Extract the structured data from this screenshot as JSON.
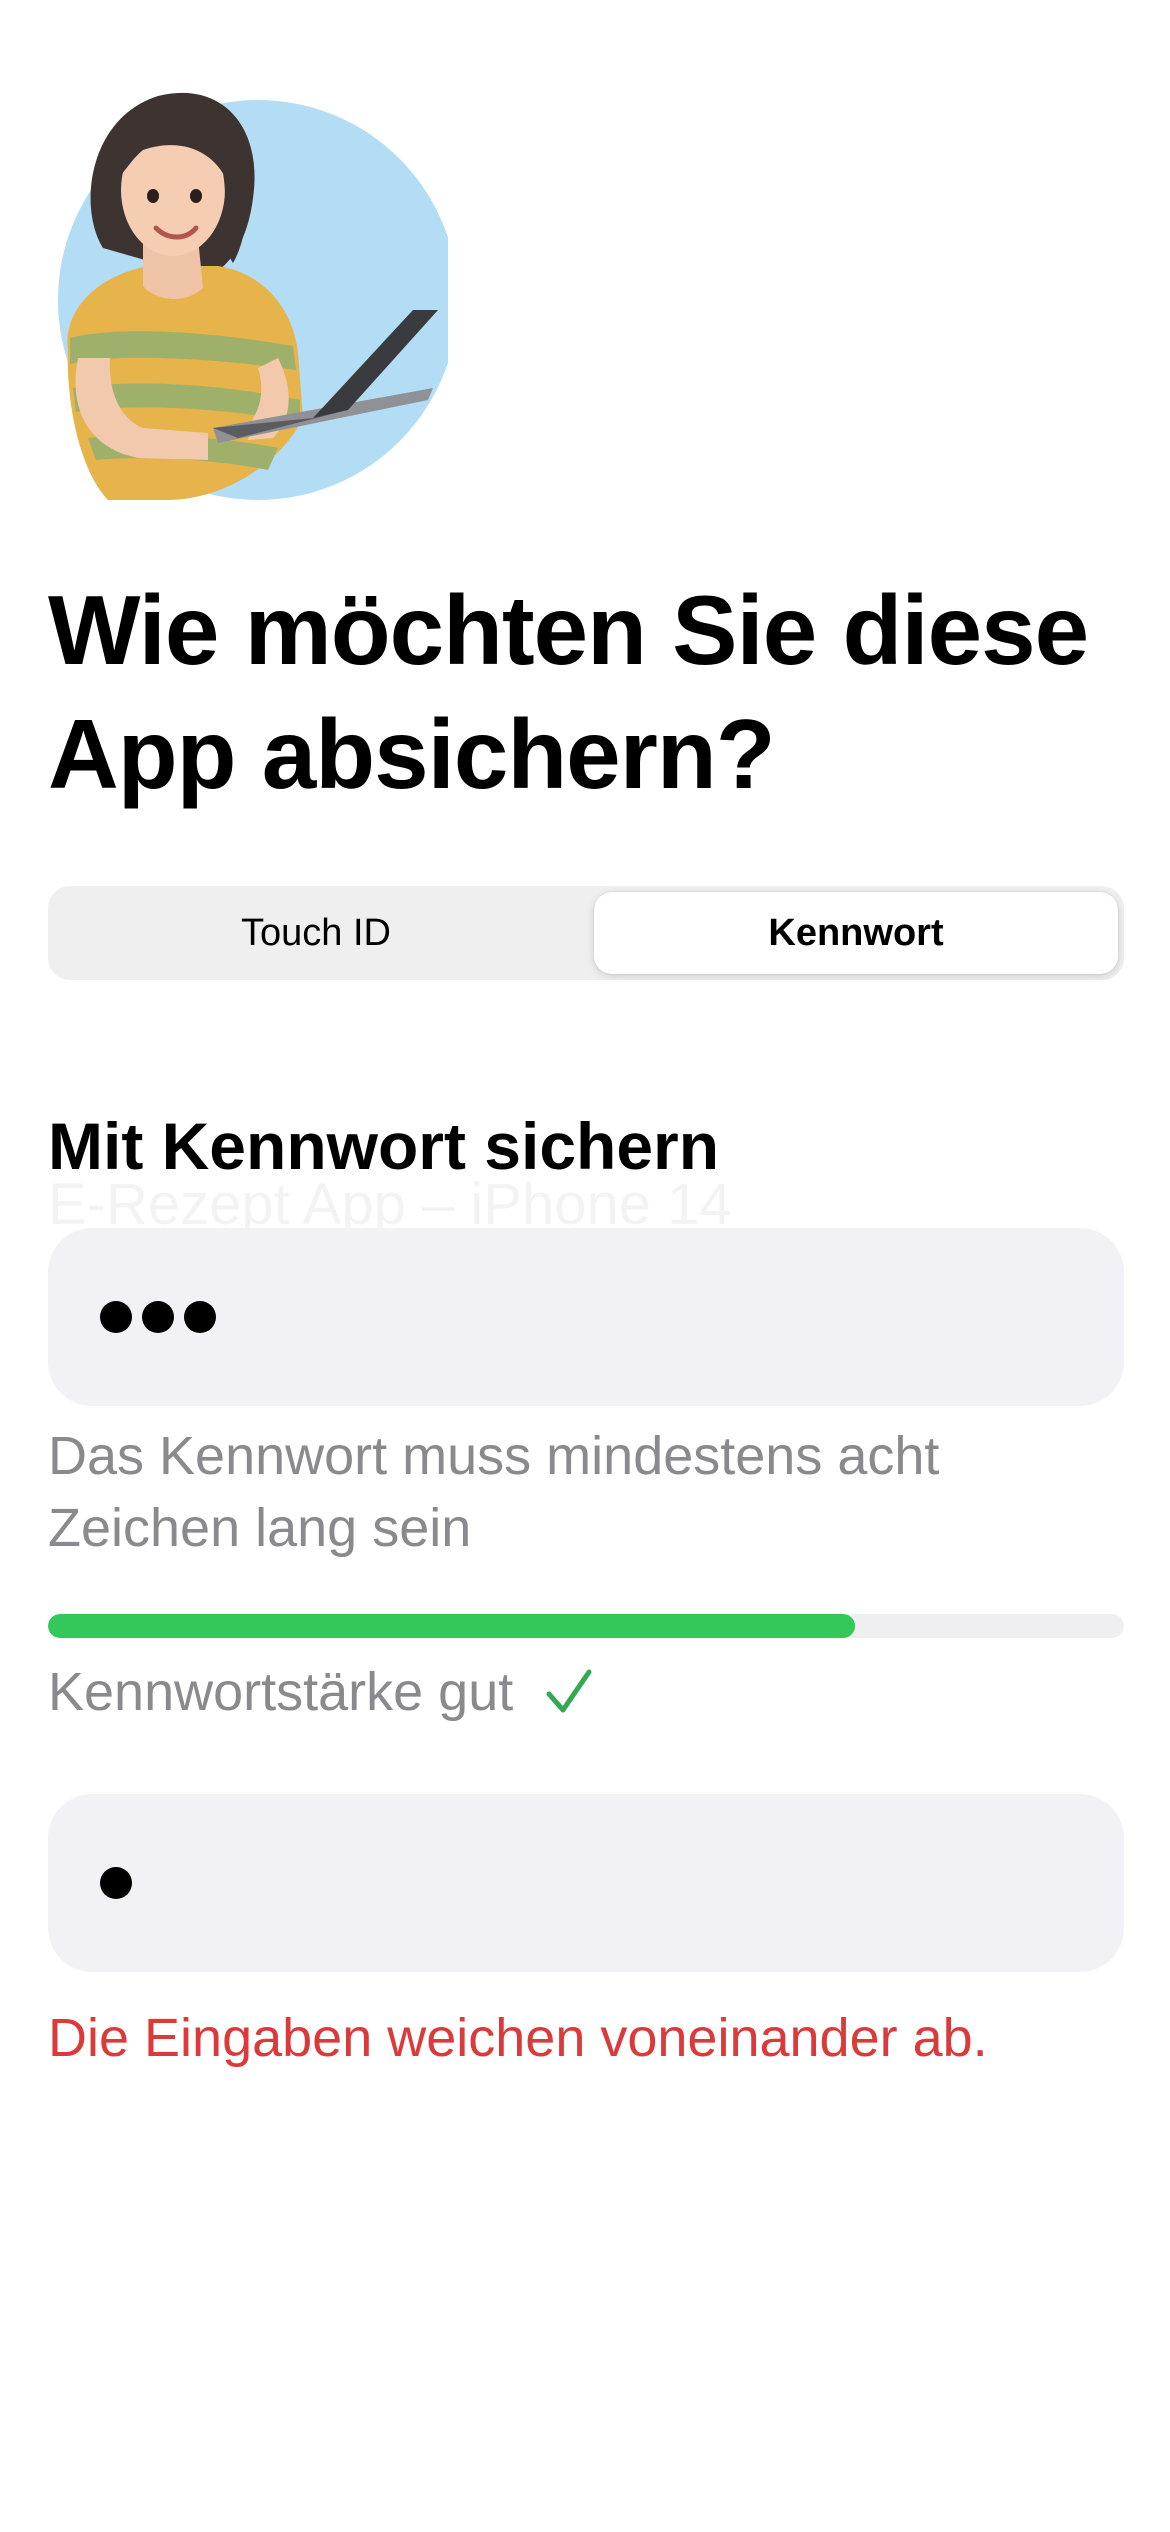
{
  "header": {
    "illustration_icon": "woman-with-laptop-illustration",
    "title": "Wie möchten Sie diese App absichern?"
  },
  "segmented_control": {
    "options": [
      {
        "label": "Touch ID",
        "selected": false
      },
      {
        "label": "Kennwort",
        "selected": true
      }
    ]
  },
  "password_section": {
    "title": "Mit Kennwort sichern",
    "faded_background_text": "E-Rezept App – iPhone 14",
    "password_field": {
      "masked_length": 3
    },
    "hint": "Das Kennwort muss mindestens acht Zeichen lang sein",
    "strength": {
      "label": "Kennwortstärke gut",
      "level_fraction": 0.75,
      "bar_color": "#34C759",
      "icon": "checkmark-icon",
      "icon_color": "#34A853"
    },
    "confirm_field": {
      "masked_length": 1
    },
    "error": {
      "text": "Die Eingaben weichen voneinander ab.",
      "color": "#DC3A3A"
    }
  }
}
